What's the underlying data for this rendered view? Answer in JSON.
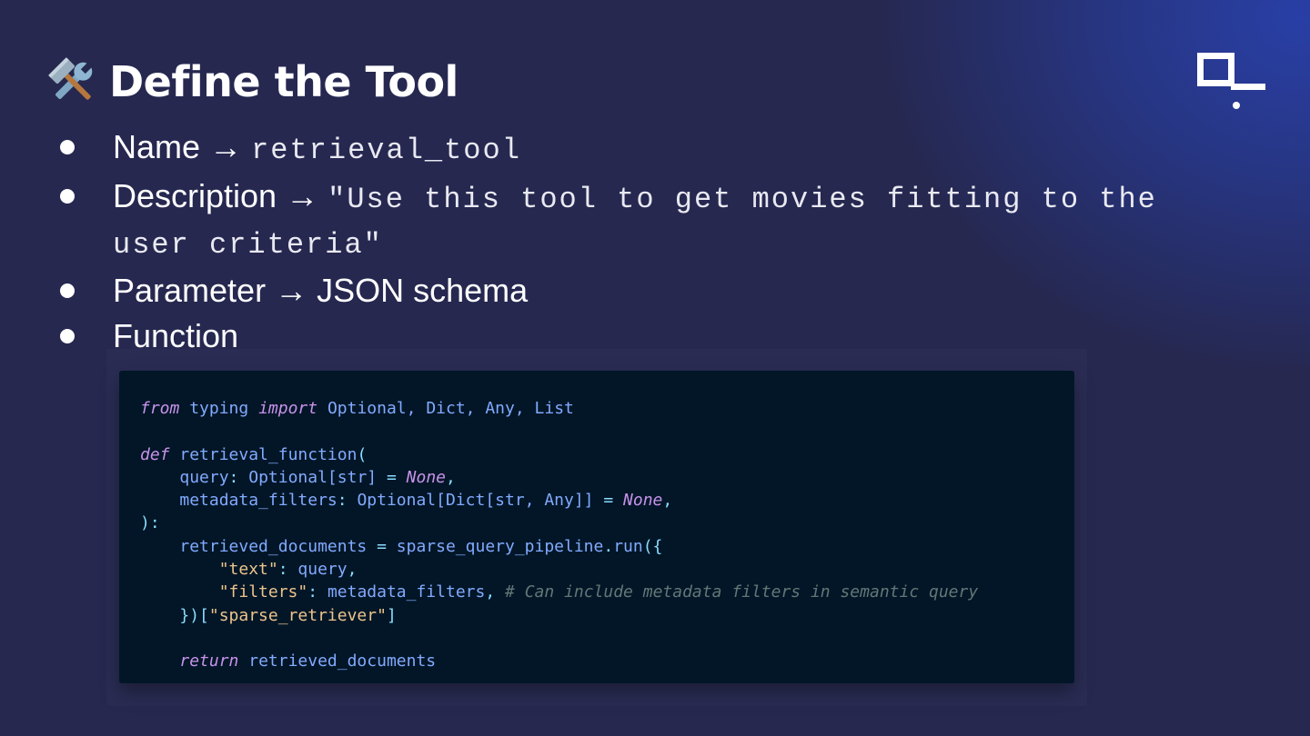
{
  "slide": {
    "title": "Define the Tool",
    "title_icon": "hammer-and-wrench-icon",
    "logo": "brand-logo-icon"
  },
  "bullets": [
    {
      "label": "Name",
      "arrow": "→",
      "value": "retrieval_tool"
    },
    {
      "label": "Description",
      "arrow": "→",
      "value": "\"Use this tool to get movies fitting to the",
      "value_cont": "user criteria\""
    },
    {
      "label": "Parameter",
      "arrow": "→",
      "value": "JSON schema"
    },
    {
      "label": "Function"
    }
  ],
  "code": {
    "language": "python",
    "l1": {
      "kw1": "from",
      "mod": "typing",
      "kw2": "import",
      "names": "Optional, Dict, Any, List"
    },
    "l3": {
      "kw": "def",
      "name": "retrieval_function",
      "paren": "("
    },
    "l4": {
      "indent": "    ",
      "param": "query",
      "colon": ": ",
      "type": "Optional[str]",
      "eq": " = ",
      "default": "None",
      "comma": ","
    },
    "l5": {
      "indent": "    ",
      "param": "metadata_filters",
      "colon": ": ",
      "type": "Optional[Dict[str, Any]]",
      "eq": " = ",
      "default": "None",
      "comma": ","
    },
    "l6": {
      "text": "):"
    },
    "l7": {
      "indent": "    ",
      "var": "retrieved_documents",
      "eq": " = ",
      "call": "sparse_query_pipeline",
      "dot": ".",
      "method": "run",
      "open": "({"
    },
    "l8": {
      "indent": "        ",
      "key": "\"text\"",
      "colon": ": ",
      "value": "query",
      "comma": ","
    },
    "l9": {
      "indent": "        ",
      "key": "\"filters\"",
      "colon": ": ",
      "value": "metadata_filters",
      "comma": ", ",
      "comment": "# Can include metadata filters in semantic query"
    },
    "l10": {
      "indent": "    ",
      "close": "})[",
      "key": "\"sparse_retriever\"",
      "end": "]"
    },
    "l12": {
      "indent": "    ",
      "kw": "return",
      "value": " retrieved_documents"
    }
  }
}
